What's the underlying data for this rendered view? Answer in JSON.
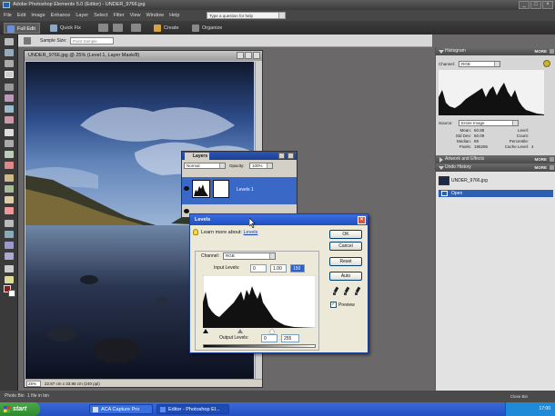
{
  "app": {
    "title": "Adobe Photoshop Elements 5.0 (Editor) - UNDER_9766.jpg",
    "window_min": "_",
    "window_max": "□",
    "window_close": "×"
  },
  "menu": {
    "items": [
      "File",
      "Edit",
      "Image",
      "Enhance",
      "Layer",
      "Select",
      "Filter",
      "View",
      "Window",
      "Help"
    ],
    "help_placeholder": "Type a question for help"
  },
  "tabs": {
    "full_edit": "Full Edit",
    "quick_fix": "Quick Fix",
    "create": "Create",
    "organize": "Organize"
  },
  "options_bar": {
    "sample_size_label": "Sample Size:",
    "sample_size_value": "Point Sample"
  },
  "document": {
    "title": "UNDER_9766.jpg @ 25% (Level 1, Layer Mask/8)",
    "zoom": "25%",
    "dimensions": "22.87 cm x 33.86 cm (240 ppi)"
  },
  "histogram_panel": {
    "title": "Histogram",
    "more": "MORE",
    "channel_label": "Channel:",
    "channel_value": "RGB",
    "source_label": "Source:",
    "source_value": "Entire Image",
    "stats_left": [
      {
        "label": "Mean:",
        "value": "60.88"
      },
      {
        "label": "Std Dev:",
        "value": "60.09"
      },
      {
        "label": "Median:",
        "value": "89"
      },
      {
        "label": "Pixels:",
        "value": "196296"
      }
    ],
    "stats_right": [
      {
        "label": "Level:",
        "value": ""
      },
      {
        "label": "Count:",
        "value": ""
      },
      {
        "label": "Percentile:",
        "value": ""
      },
      {
        "label": "Cache Level:",
        "value": "4"
      }
    ]
  },
  "artwork_panel": {
    "title": "Artwork and Effects",
    "more": "MORE"
  },
  "undo_panel": {
    "title": "Undo History",
    "more": "MORE",
    "items": [
      "UNDER_9766.jpg",
      "Open"
    ]
  },
  "layers_palette": {
    "tab": "Layers",
    "blend_mode": "Normal",
    "opacity_label": "Opacity:",
    "opacity_value": "100%",
    "layer_name": "Levels 1"
  },
  "levels_dialog": {
    "title": "Levels",
    "close": "×",
    "learn_more": "Learn more about:",
    "learn_more_link": "Levels",
    "channel_label": "Channel:",
    "channel_value": "RGB",
    "input_levels_label": "Input Levels:",
    "input_black": "0",
    "input_gamma": "1.00",
    "input_white": "150",
    "output_levels_label": "Output Levels:",
    "output_black": "0",
    "output_white": "255",
    "buttons": {
      "ok": "OK",
      "cancel": "Cancel",
      "reset": "Reset",
      "auto": "Auto"
    },
    "preview_label": "Preview",
    "preview_checked": true
  },
  "status_bar": {
    "photo_bin": "Photo Bin",
    "file_count": "1 file in bin",
    "close_bin": "Close Bin"
  },
  "taskbar": {
    "start": "start",
    "tasks": [
      "ACA Capture Pro",
      "Editor - Photoshop El..."
    ],
    "clock": "17:00"
  }
}
